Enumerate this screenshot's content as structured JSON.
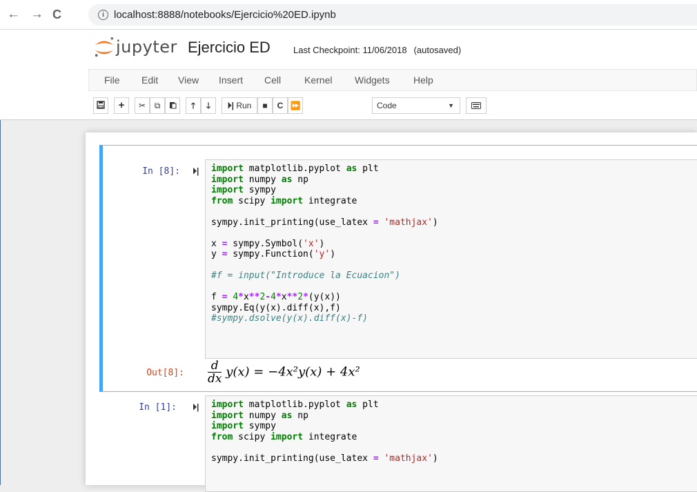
{
  "browser": {
    "back": "←",
    "forward": "→",
    "reload": "C",
    "url": "localhost:8888/notebooks/Ejercicio%20ED.ipynb"
  },
  "header": {
    "logo_text": "jupyter",
    "notebook_title": "Ejercicio ED",
    "checkpoint_label": "Last Checkpoint: 11/06/2018",
    "autosave_status": "(autosaved)"
  },
  "menu": [
    "File",
    "Edit",
    "View",
    "Insert",
    "Cell",
    "Kernel",
    "Widgets",
    "Help"
  ],
  "toolbar": {
    "run_label": "Run",
    "cell_type": "Code"
  },
  "cells": [
    {
      "prompt": "In [8]:",
      "out_prompt": "Out[8]:",
      "output": {
        "frac_num": "d",
        "frac_den": "dx",
        "expr": "y(x) = −4x²y(x) + 4x²"
      }
    },
    {
      "prompt": "In [1]:"
    }
  ],
  "colors": {
    "accent": "#42a5f5",
    "in_prompt": "#303f9f",
    "out_prompt": "#d84315",
    "logo_orange": "#f37726"
  },
  "icons": [
    "save-icon",
    "plus-icon",
    "cut-icon",
    "copy-icon",
    "paste-icon",
    "arrow-up-icon",
    "arrow-down-icon",
    "run-icon",
    "stop-icon",
    "restart-icon",
    "fast-forward-icon",
    "keyboard-icon"
  ]
}
